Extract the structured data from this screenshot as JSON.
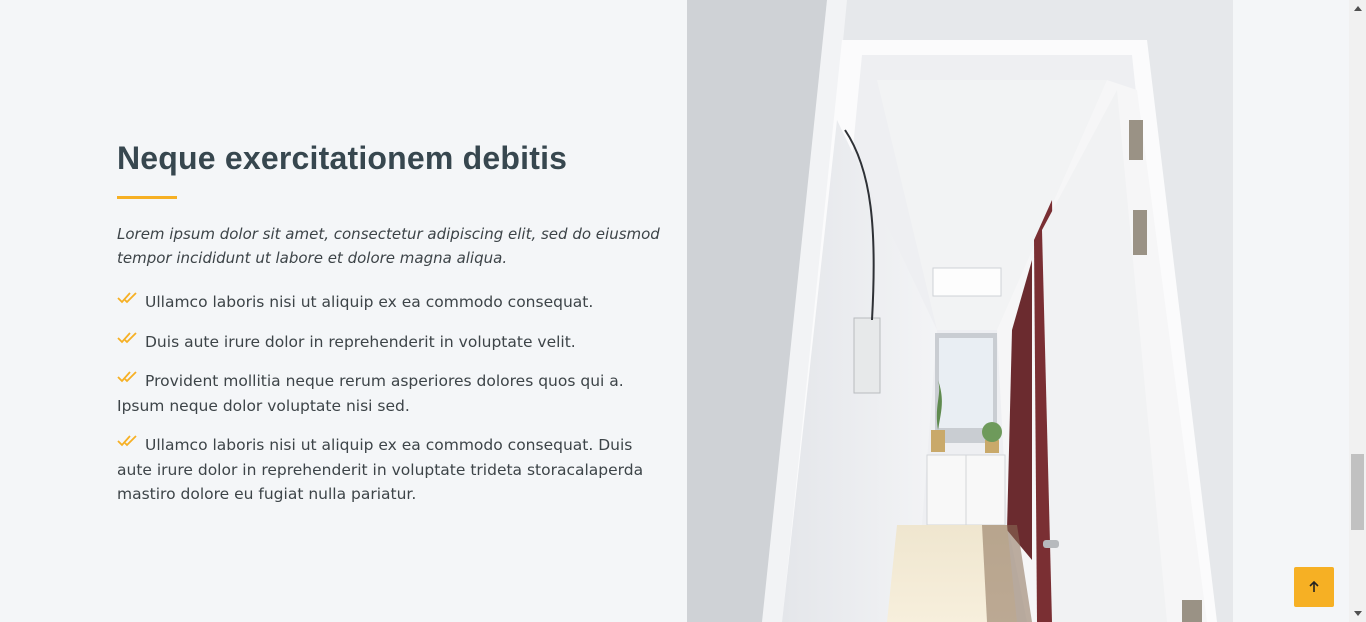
{
  "about": {
    "title": "Neque exercitationem debitis",
    "lead": "Lorem ipsum dolor sit amet, consectetur adipiscing elit, sed do eiusmod tempor incididunt ut labore et dolore magna aliqua.",
    "features": [
      "Ullamco laboris nisi ut aliquip ex ea commodo consequat.",
      "Duis aute irure dolor in reprehenderit in voluptate velit.",
      "Provident mollitia neque rerum asperiores dolores quos qui a. Ipsum neque dolor voluptate nisi sed.",
      "Ullamco laboris nisi ut aliquip ex ea commodo consequat. Duis aute irure dolor in reprehenderit in voluptate trideta storacalaperda mastiro dolore eu fugiat nulla pariatur."
    ],
    "check_icon": "double-check-icon",
    "photo": "office-hallway-photo"
  },
  "back_to_top": {
    "icon": "arrow-up-icon"
  },
  "colors": {
    "accent": "#f6b024",
    "heading": "#37474f",
    "background": "#f4f6f8",
    "text": "#3d4448"
  }
}
